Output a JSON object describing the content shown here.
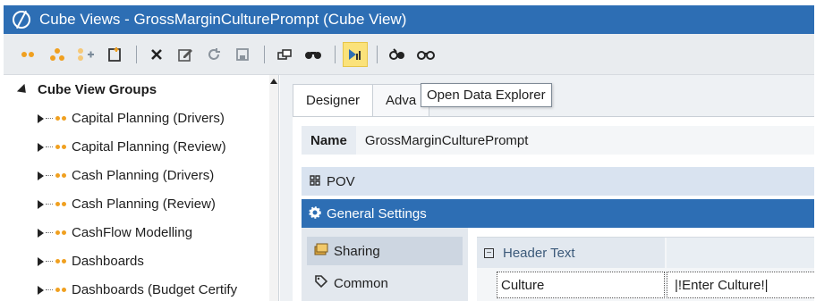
{
  "window": {
    "title": "Cube Views - GrossMarginCulturePrompt (Cube View)"
  },
  "toolbar": {
    "icons": [
      "dots-icon",
      "group-icon",
      "add-dots-icon",
      "new-doc-icon",
      "delete-icon",
      "edit-icon",
      "refresh-icon",
      "save-icon",
      "copy-icon",
      "search-binoculars-icon",
      "open-data-explorer-icon",
      "object-lookup-icon",
      "compare-icon"
    ],
    "tooltip": "Open Data Explorer",
    "colors": {
      "accent": "#2d6eb4",
      "highlight": "#fbe27a"
    }
  },
  "sidebar": {
    "root_label": "Cube View Groups",
    "items": [
      {
        "label": "Capital Planning (Drivers)"
      },
      {
        "label": "Capital Planning (Review)"
      },
      {
        "label": "Cash Planning (Drivers)"
      },
      {
        "label": "Cash Planning (Review)"
      },
      {
        "label": "CashFlow Modelling"
      },
      {
        "label": "Dashboards"
      },
      {
        "label": "Dashboards (Budget Certify"
      }
    ]
  },
  "main": {
    "tabs": [
      {
        "label": "Designer"
      },
      {
        "label": "Adva"
      }
    ],
    "name_label": "Name",
    "name_value": "GrossMarginCulturePrompt",
    "pov_label": "POV",
    "general_settings_label": "General Settings",
    "side_tabs": [
      {
        "label": "Sharing"
      },
      {
        "label": "Common"
      }
    ],
    "grid": {
      "header_label": "Header Text",
      "header_toggle": "−",
      "row_name": "Culture",
      "row_value": "|!Enter Culture!|"
    }
  }
}
